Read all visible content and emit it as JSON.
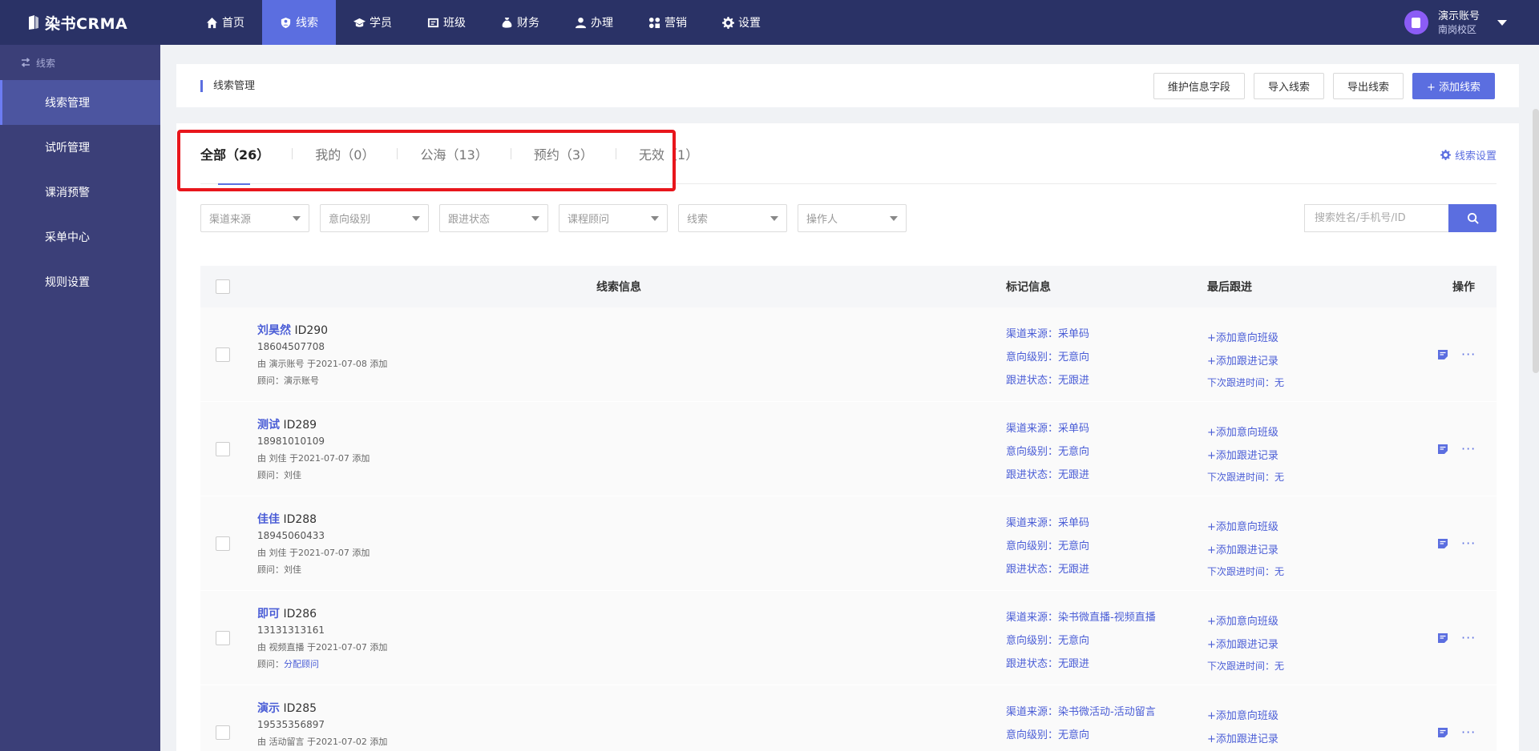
{
  "app": {
    "logo_text": "染书CRMA"
  },
  "nav": [
    {
      "label": "首页",
      "icon": "home-icon"
    },
    {
      "label": "线索",
      "icon": "clue-icon",
      "active": true
    },
    {
      "label": "学员",
      "icon": "student-icon"
    },
    {
      "label": "班级",
      "icon": "class-icon"
    },
    {
      "label": "财务",
      "icon": "finance-icon"
    },
    {
      "label": "办理",
      "icon": "handle-icon"
    },
    {
      "label": "营销",
      "icon": "marketing-icon"
    },
    {
      "label": "设置",
      "icon": "gear-icon"
    }
  ],
  "user": {
    "name": "演示账号",
    "campus": "南岗校区"
  },
  "sidebar": {
    "header": "线索",
    "items": [
      {
        "label": "线索管理",
        "active": true
      },
      {
        "label": "试听管理"
      },
      {
        "label": "课消预警"
      },
      {
        "label": "采单中心"
      },
      {
        "label": "规则设置"
      }
    ]
  },
  "page": {
    "title": "线索管理",
    "actions": {
      "maintain": "维护信息字段",
      "import": "导入线索",
      "export": "导出线索",
      "add": "+ 添加线索"
    }
  },
  "tabs": [
    {
      "label": "全部（26）",
      "active": true
    },
    {
      "label": "我的（0）"
    },
    {
      "label": "公海（13）"
    },
    {
      "label": "预约（3）"
    },
    {
      "label": "无效（1）"
    }
  ],
  "tab_settings": "线索设置",
  "filters": [
    "渠道来源",
    "意向级别",
    "跟进状态",
    "课程顾问",
    "线索",
    "操作人"
  ],
  "search": {
    "placeholder": "搜索姓名/手机号/ID"
  },
  "table": {
    "headers": {
      "info": "线索信息",
      "mark": "标记信息",
      "last": "最后跟进",
      "op": "操作"
    },
    "rows": [
      {
        "name": "刘昊然",
        "id": "ID290",
        "phone": "18604507708",
        "added": "由 演示账号 于2021-07-08 添加",
        "adviser_label": "顾问：",
        "adviser": "演示账号",
        "channel": "渠道来源：采单码",
        "level": "意向级别：无意向",
        "status": "跟进状态：无跟进",
        "add_class": "+添加意向班级",
        "add_record": "+添加跟进记录",
        "next": "下次跟进时间：无"
      },
      {
        "name": "测试",
        "id": "ID289",
        "phone": "18981010109",
        "added": "由 刘佳 于2021-07-07 添加",
        "adviser_label": "顾问：",
        "adviser": "刘佳",
        "channel": "渠道来源：采单码",
        "level": "意向级别：无意向",
        "status": "跟进状态：无跟进",
        "add_class": "+添加意向班级",
        "add_record": "+添加跟进记录",
        "next": "下次跟进时间：无"
      },
      {
        "name": "佳佳",
        "id": "ID288",
        "phone": "18945060433",
        "added": "由 刘佳 于2021-07-07 添加",
        "adviser_label": "顾问：",
        "adviser": "刘佳",
        "channel": "渠道来源：采单码",
        "level": "意向级别：无意向",
        "status": "跟进状态：无跟进",
        "add_class": "+添加意向班级",
        "add_record": "+添加跟进记录",
        "next": "下次跟进时间：无"
      },
      {
        "name": "即可",
        "id": "ID286",
        "phone": "13131313161",
        "added": "由 视频直播 于2021-07-07 添加",
        "adviser_label": "顾问：",
        "adviser": "分配顾问",
        "channel": "渠道来源：染书微直播-视频直播",
        "level": "意向级别：无意向",
        "status": "跟进状态：无跟进",
        "add_class": "+添加意向班级",
        "add_record": "+添加跟进记录",
        "next": "下次跟进时间：无"
      },
      {
        "name": "演示",
        "id": "ID285",
        "phone": "19535356897",
        "added": "由 活动留言 于2021-07-02 添加",
        "adviser_label": "",
        "adviser": "",
        "channel": "渠道来源：染书微活动-活动留言",
        "level": "意向级别：无意向",
        "status": "",
        "add_class": "+添加意向班级",
        "add_record": "+添加跟进记录",
        "next": ""
      }
    ]
  },
  "colors": {
    "topbar": "#2a3266",
    "sidebar": "#3b3f78",
    "accent": "#5b6ee0",
    "highlight": "#e8161c"
  }
}
